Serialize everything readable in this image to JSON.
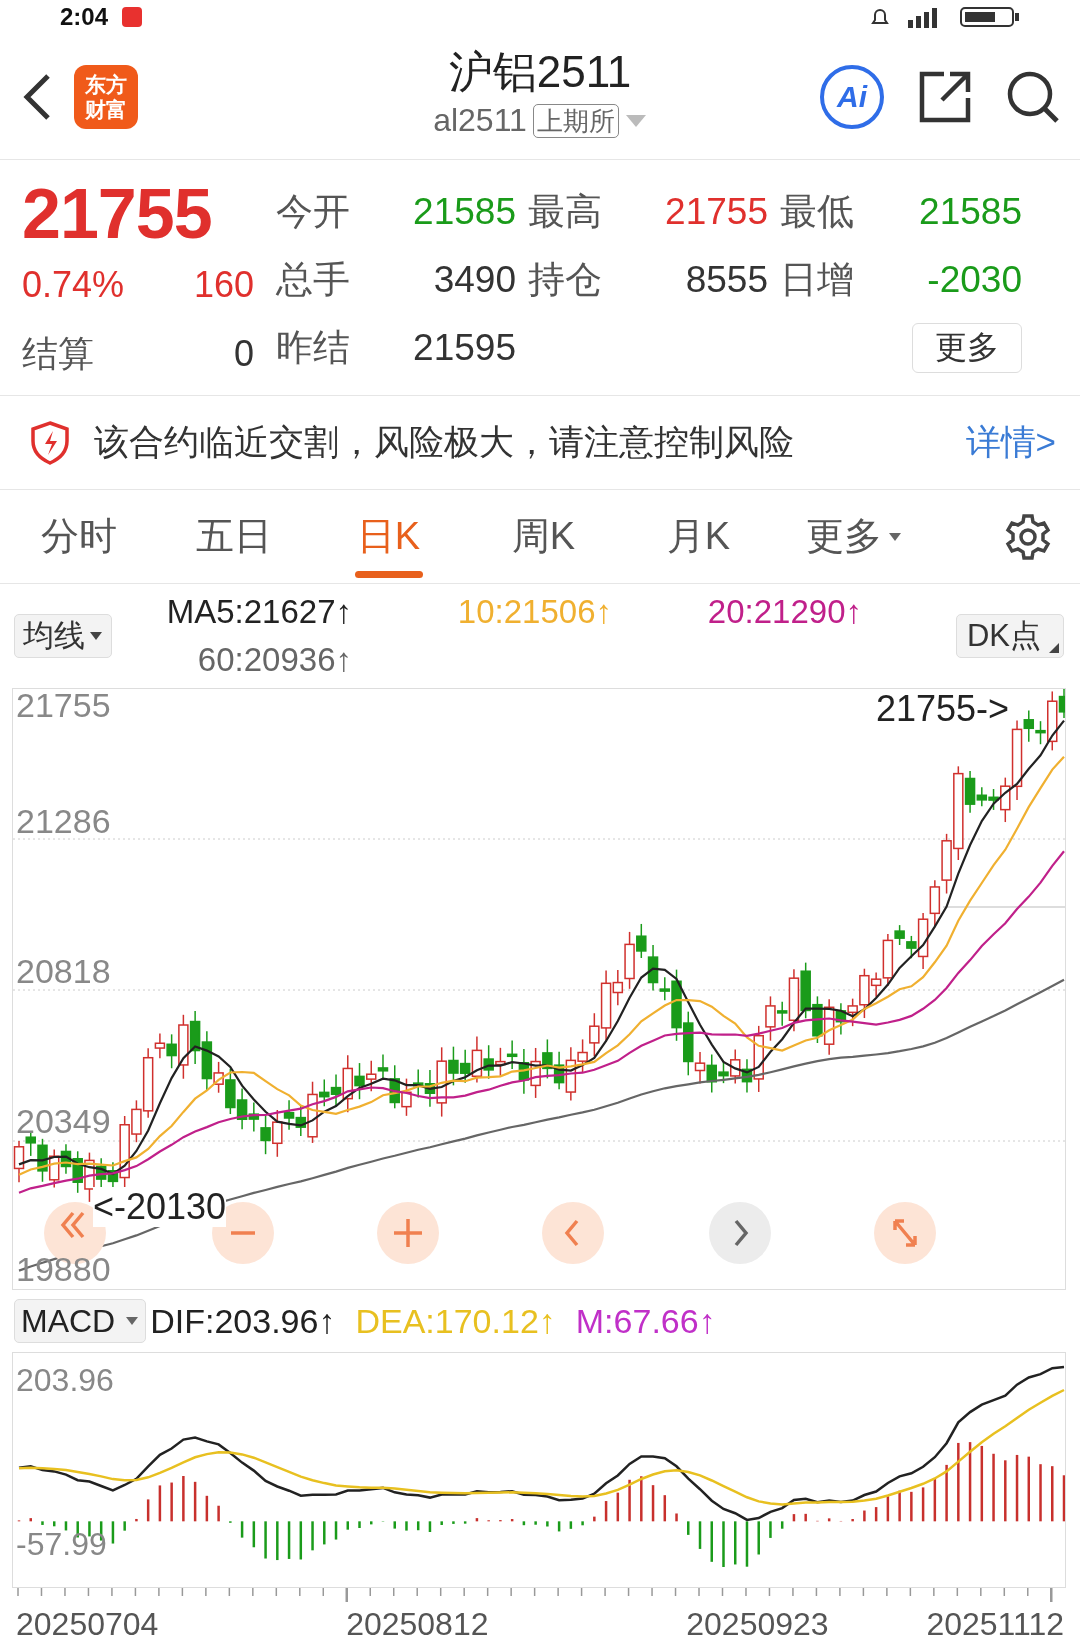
{
  "status_bar": {
    "time": "2:04"
  },
  "header": {
    "logo": "东方财富",
    "title": "沪铝2511",
    "code": "al2511",
    "exchange": "上期所",
    "ai_button": "Ai"
  },
  "quote": {
    "price": "21755",
    "change_pct": "0.74%",
    "change": "160",
    "settle_label": "结算",
    "settle_value": "0",
    "fields": [
      {
        "label": "今开",
        "value": "21585",
        "color": "#1a9b1a"
      },
      {
        "label": "最高",
        "value": "21755",
        "color": "#e0302d"
      },
      {
        "label": "最低",
        "value": "21585",
        "color": "#1a9b1a"
      },
      {
        "label": "总手",
        "value": "3490",
        "color": "#333333"
      },
      {
        "label": "持仓",
        "value": "8555",
        "color": "#333333"
      },
      {
        "label": "日增",
        "value": "-2030",
        "color": "#1a9b1a"
      },
      {
        "label": "昨结",
        "value": "21595",
        "color": "#333333"
      }
    ],
    "more_button": "更多"
  },
  "risk_notice": {
    "text": "该合约临近交割，风险极大，请注意控制风险",
    "link": "详情>"
  },
  "tabs": [
    {
      "label": "分时",
      "kind": "plain",
      "selected": false
    },
    {
      "label": "五日",
      "kind": "plain",
      "selected": false
    },
    {
      "label": "日K",
      "kind": "plain",
      "selected": true
    },
    {
      "label": "周K",
      "kind": "plain",
      "selected": false
    },
    {
      "label": "月K",
      "kind": "plain",
      "selected": false
    },
    {
      "label": "更多",
      "kind": "dropdown",
      "selected": false
    }
  ],
  "indicator_select": "均线",
  "ma_legend": [
    {
      "text": "MA5:21627↑",
      "color": "#222222"
    },
    {
      "text": "10:21506↑",
      "color": "#f0b030"
    },
    {
      "text": "20:21290↑",
      "color": "#c0208a"
    },
    {
      "text": "60:20936↑",
      "color": "#666666"
    }
  ],
  "dk_button": "DK点",
  "kline_chart": {
    "y_labels": [
      "21755",
      "21286",
      "20818",
      "20349",
      "19880"
    ],
    "high_marker": "21755->",
    "low_marker": "<-20130"
  },
  "macd_select": "MACD",
  "macd_legend": [
    {
      "text": "DIF:203.96↑",
      "color": "#222222"
    },
    {
      "text": "DEA:170.12↑",
      "color": "#e8c020"
    },
    {
      "text": "M:67.66↑",
      "color": "#c030c8"
    }
  ],
  "macd_chart": {
    "y_labels": [
      "203.96",
      "-57.99"
    ]
  },
  "dates": [
    "20250704",
    "20250812",
    "20250923",
    "20251112"
  ]
}
